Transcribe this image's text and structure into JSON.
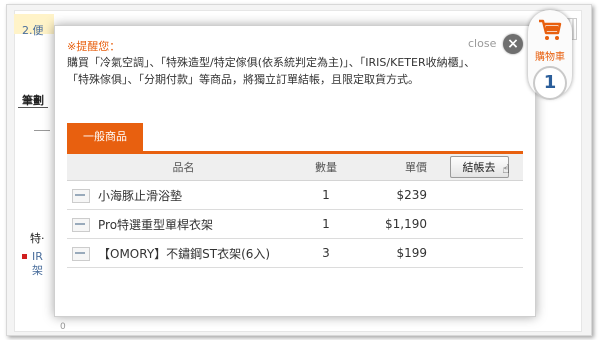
{
  "background": {
    "top_text": "2.便",
    "left_heading": "筆劃",
    "left_item_1": "特·",
    "left_item_2a": "IR",
    "left_item_2b": "架",
    "bottom_text": "0"
  },
  "notice": {
    "title": "提醒您：",
    "body": "購買「冷氣空調」、「特殊造型/特定傢俱(依系統判定為主)」、「IRIS/KETER收納櫃」、「特殊傢俱」、「分期付款」等商品，將獨立訂單結帳，且限定取貨方式。",
    "close_label": "close",
    "close_symbol": "×"
  },
  "tabs": [
    {
      "label": "一般商品",
      "active": true
    }
  ],
  "table": {
    "headers": {
      "name": "品名",
      "qty": "數量",
      "price": "單價"
    },
    "checkout_label": "結帳去",
    "rows": [
      {
        "name": "小海豚止滑浴墊",
        "qty": "1",
        "price": "$239"
      },
      {
        "name": "Pro特選重型單桿衣架",
        "qty": "1",
        "price": "$1,190"
      },
      {
        "name": "【OMORY】不鏽鋼ST衣架(6入)",
        "qty": "3",
        "price": "$199"
      }
    ]
  },
  "cart": {
    "label": "購物車",
    "count": "1",
    "icon": "shopping-cart-icon"
  },
  "colors": {
    "accent": "#e8600f",
    "count": "#2b5e9a"
  }
}
